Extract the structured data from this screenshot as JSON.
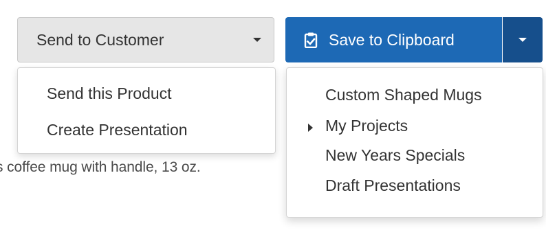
{
  "background": {
    "product_text": "s coffee mug with handle, 13 oz."
  },
  "send_to_customer": {
    "label": "Send to Customer",
    "caret_icon": "chevron-down-icon",
    "menu": [
      {
        "label": "Send this Product"
      },
      {
        "label": "Create Presentation"
      }
    ]
  },
  "save_to_clipboard": {
    "label": "Save to Clipboard",
    "icon": "clipboard-check-icon",
    "caret_icon": "chevron-down-icon",
    "menu": [
      {
        "label": "Custom Shaped Mugs",
        "has_submenu": false
      },
      {
        "label": "My Projects",
        "has_submenu": true
      },
      {
        "label": "New Years Specials",
        "has_submenu": false
      },
      {
        "label": "Draft Presentations",
        "has_submenu": false
      }
    ]
  },
  "colors": {
    "primary": "#1d69b5",
    "primary_dark": "#164f8c",
    "default_button": "#e6e6e6"
  }
}
